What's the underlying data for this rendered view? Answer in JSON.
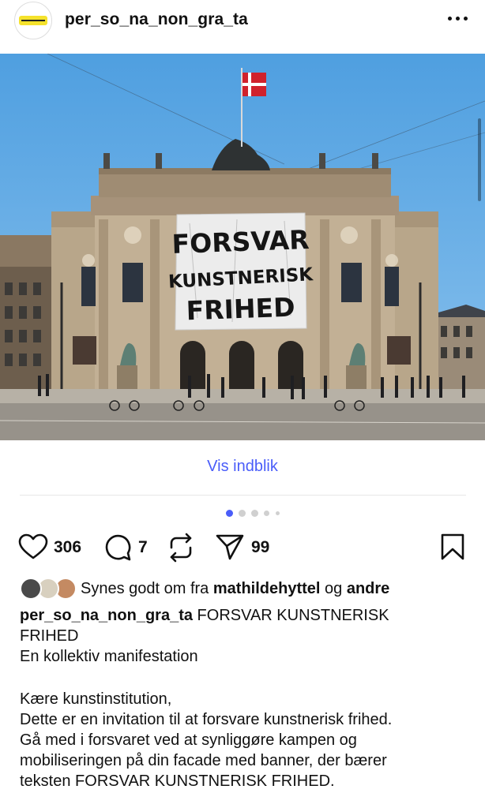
{
  "post": {
    "username": "per_so_na_non_gra_ta",
    "avatar_icon": "profile-logo-icon",
    "more_icon": "more-dots-icon"
  },
  "photo": {
    "banner_lines": [
      "FORSVAR",
      "KUNSTNERISK",
      "FRIHED"
    ],
    "flag": "danish-flag"
  },
  "insight_label": "Vis indblik",
  "carousel": {
    "active_index": 0,
    "dot_count": 5
  },
  "actions": {
    "likes": "306",
    "comments": "7",
    "shares": "99",
    "icons": [
      "heart-icon",
      "comment-icon",
      "repost-icon",
      "send-icon",
      "bookmark-icon"
    ]
  },
  "liked_by": {
    "prefix": "Synes godt om fra",
    "user": "mathildehyttel",
    "connector": "og",
    "others": "andre"
  },
  "caption": {
    "username": "per_so_na_non_gra_ta",
    "title_line1": "FORSVAR KUNSTNERISK",
    "title_line2": "FRIHED",
    "subtitle": "En kollektiv manifestation",
    "greeting": "Kære kunstinstitution,",
    "body_line1": "Dette er en invitation til at forsvare kunstnerisk frihed.",
    "body_line2": "Gå med i forsvaret ved at synliggøre kampen og",
    "body_line3": "mobiliseringen på din facade med banner, der bærer",
    "body_line4": "teksten FORSVAR KUNSTNERISK FRIHED."
  },
  "colors": {
    "link": "#4a5df9",
    "sky": "#5ea8e2"
  }
}
